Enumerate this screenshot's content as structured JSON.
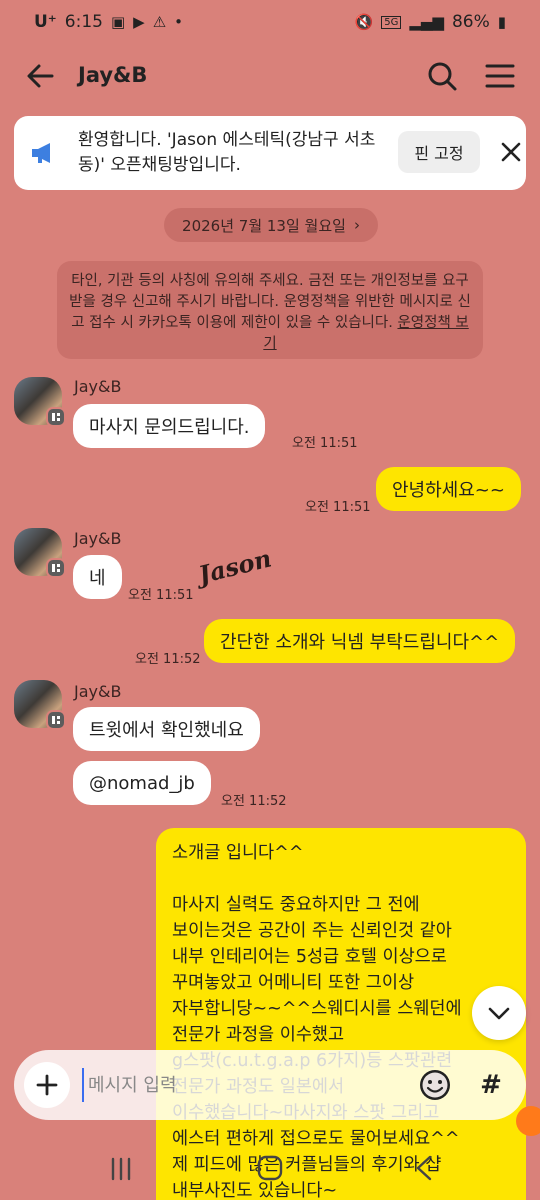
{
  "status_bar": {
    "carrier": "U⁺",
    "time": "6:15",
    "network": "5G",
    "battery": "86%"
  },
  "header": {
    "title": "Jay&B"
  },
  "notice": {
    "text": "환영합니다. 'Jason 에스테틱(강남구 서초동)' 오픈채팅방입니다.",
    "pin_label": "핀 고정"
  },
  "date_divider": "2026년 7월 13일 월요일",
  "warning": {
    "text": "타인, 기관 등의 사칭에 유의해 주세요. 금전 또는 개인정보를 요구 받을 경우 신고해 주시기 바랍니다. 운영정책을 위반한 메시지로 신고 접수 시 카카오톡 이용에 제한이 있을 수 있습니다.",
    "link": "운영정책 보기"
  },
  "watermark": "Jason",
  "messages": [
    {
      "sender": "Jay&B",
      "text": "마사지 문의드립니다.",
      "time": "오전 11:51"
    },
    {
      "mine": true,
      "text": "안녕하세요~~",
      "time": "오전 11:51"
    },
    {
      "sender": "Jay&B",
      "text": "네",
      "time": "오전 11:51"
    },
    {
      "mine": true,
      "text": "간단한 소개와 닉넴 부탁드립니다^^",
      "time": "오전 11:52"
    },
    {
      "sender": "Jay&B",
      "text": "트윗에서 확인했네요",
      "time": ""
    },
    {
      "text": "@nomad_jb",
      "time": "오전 11:52"
    },
    {
      "mine": true,
      "text": "소개글 입니다^^\n\n마사지 실력도 중요하지만 그 전에\n보이는것은 공간이 주는 신뢰인것 같아\n내부 인테리어는 5성급 호텔 이상으로\n꾸며놓았고 어메니티 또한 그이상\n자부합니당~~^^스웨디시를 스웨던에\n전문가 과정을 이수했고\ng스팟(c.u.t.g.a.p 6가지)등 스팟관련\n전문가 과정도 일본에서\n이수했습니다~마사지와 스팟 그리고\n에스터 편하게 접으로도 물어보세요^^\n제 피드에 많은 커플님들의 후기와 샵\n내부사진도 있습니다~",
      "time": ""
    }
  ],
  "input": {
    "placeholder": "메시지 입력"
  }
}
